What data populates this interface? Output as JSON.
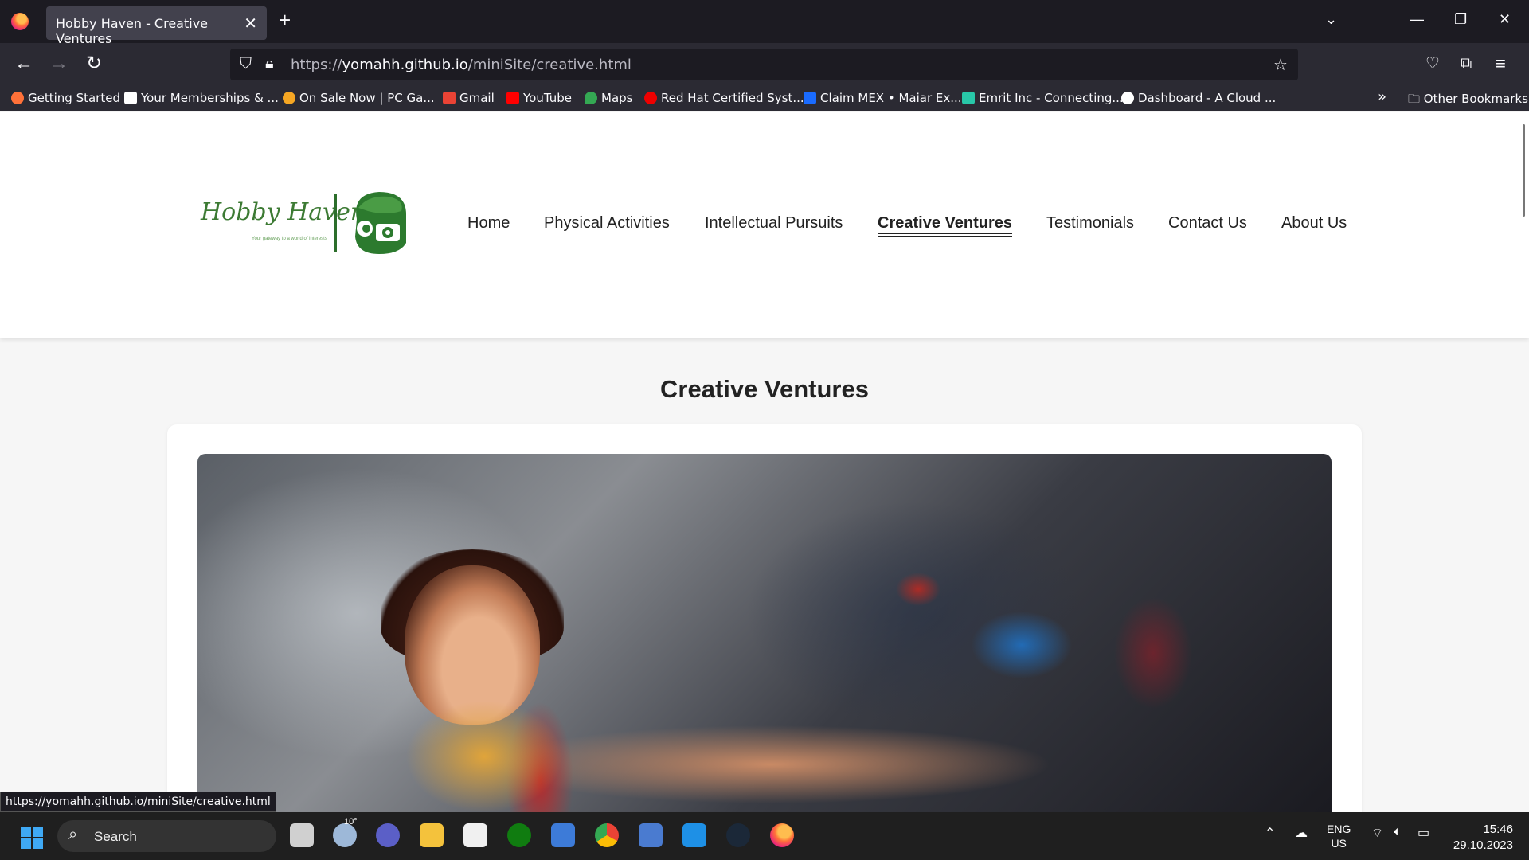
{
  "browser": {
    "tab_title": "Hobby Haven - Creative Ventures",
    "url_prefix": "https://",
    "url_domain": "yomahh.github.io",
    "url_path": "/miniSite/creative.html",
    "bookmarks": [
      {
        "label": "Getting Started",
        "color": "#ff7139"
      },
      {
        "label": "Your Memberships & ...",
        "color": "#ffffff"
      },
      {
        "label": "On Sale Now | PC Ga...",
        "color": "#f5a623"
      },
      {
        "label": "Gmail",
        "color": "#ea4335"
      },
      {
        "label": "YouTube",
        "color": "#ff0000"
      },
      {
        "label": "Maps",
        "color": "#34a853"
      },
      {
        "label": "Red Hat Certified Syst...",
        "color": "#ee0000"
      },
      {
        "label": "Claim MEX • Maiar Ex...",
        "color": "#1a6bff"
      },
      {
        "label": "Emrit Inc - Connecting...",
        "color": "#28c7a8"
      },
      {
        "label": "Dashboard - A Cloud ...",
        "color": "#ffffff"
      }
    ],
    "other_bookmarks": "Other Bookmarks",
    "status_url": "https://yomahh.github.io/miniSite/creative.html"
  },
  "site": {
    "logo_text": "Hobby Haven",
    "logo_tagline": "Your gateway to a world of interests",
    "brand_color": "#3c7a33",
    "nav": [
      {
        "label": "Home"
      },
      {
        "label": "Physical Activities"
      },
      {
        "label": "Intellectual Pursuits"
      },
      {
        "label": "Creative Ventures",
        "active": true
      },
      {
        "label": "Testimonials"
      },
      {
        "label": "Contact Us"
      },
      {
        "label": "About Us"
      }
    ],
    "page_title": "Creative Ventures"
  },
  "taskbar": {
    "search_label": "Search",
    "weather": "10°",
    "lang_top": "ENG",
    "lang_bottom": "US",
    "time": "15:46",
    "date": "29.10.2023"
  }
}
